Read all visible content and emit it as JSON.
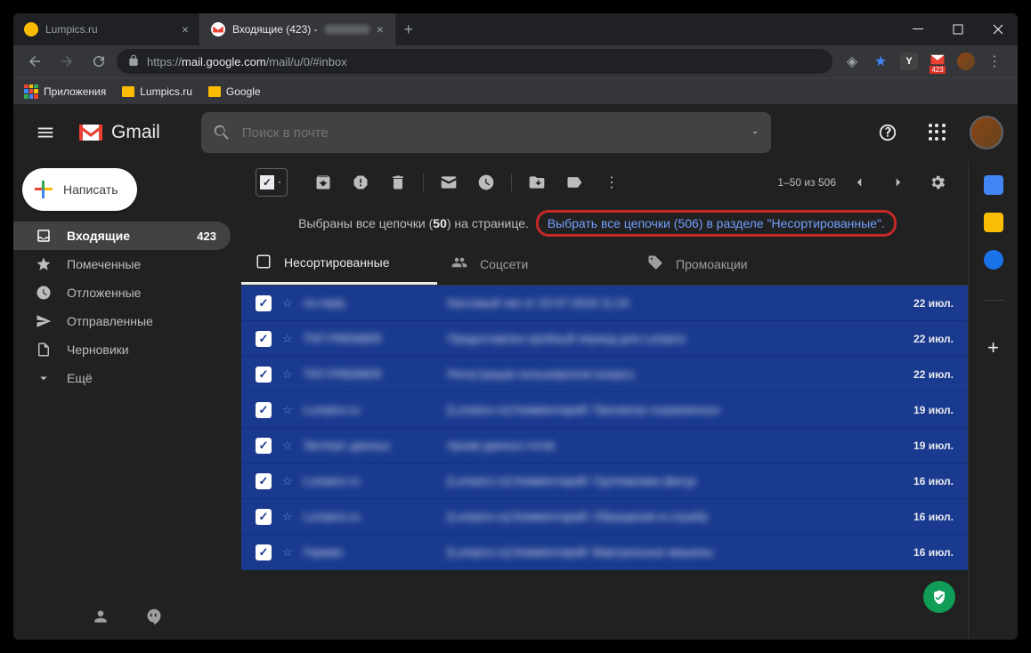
{
  "browser": {
    "tabs": [
      {
        "title": "Lumpics.ru",
        "active": false
      },
      {
        "title": "Входящие (423) -",
        "active": true
      }
    ],
    "url_prefix": "https://",
    "url_host": "mail.google.com",
    "url_path": "/mail/u/0/#inbox",
    "bookmarks": [
      "Приложения",
      "Lumpics.ru",
      "Google"
    ],
    "gmail_badge": "423"
  },
  "gmail": {
    "brand": "Gmail",
    "search_placeholder": "Поиск в почте",
    "compose": "Написать",
    "nav": [
      {
        "icon": "inbox",
        "label": "Входящие",
        "badge": "423",
        "active": true
      },
      {
        "icon": "star",
        "label": "Помеченные"
      },
      {
        "icon": "clock",
        "label": "Отложенные"
      },
      {
        "icon": "send",
        "label": "Отправленные"
      },
      {
        "icon": "draft",
        "label": "Черновики"
      },
      {
        "icon": "more",
        "label": "Ещё"
      }
    ],
    "pager": "1–50 из 506",
    "banner_text_a": "Выбраны все цепочки (",
    "banner_count": "50",
    "banner_text_b": ") на странице.",
    "banner_link": "Выбрать все цепочки (506) в разделе \"Несортированные\".",
    "categories": [
      {
        "label": "Несортированные",
        "active": true
      },
      {
        "label": "Соцсети"
      },
      {
        "label": "Промоакции"
      }
    ],
    "mails": [
      {
        "sender": "no-reply",
        "subject": "Кассовый чек от 22-07-2019 11:24",
        "date": "22 июл."
      },
      {
        "sender": "TNT-PREMIER",
        "subject": "Предоставлен пробный период для Lumpics",
        "date": "22 июл."
      },
      {
        "sender": "TNT-PREMIER",
        "subject": "Регистрация пользователя lumpics",
        "date": "22 июл."
      },
      {
        "sender": "Lumpics.ru",
        "subject": "[Lumpics.ru] Комментарий: Просмотр сохраненных",
        "date": "19 июл."
      },
      {
        "sender": "Экспорт данных",
        "subject": "Архив данных готов",
        "date": "19 июл."
      },
      {
        "sender": "Lumpics.ru",
        "subject": "[Lumpics.ru] Комментарий: Группировка фигур",
        "date": "16 июл."
      },
      {
        "sender": "Lumpics.ru",
        "subject": "[Lumpics.ru] Комментарий: Обращение в службу",
        "date": "16 июл."
      },
      {
        "sender": "Герман",
        "subject": "[Lumpics.ru] Комментарий: Виртуальные машины",
        "date": "16 июл."
      }
    ]
  }
}
